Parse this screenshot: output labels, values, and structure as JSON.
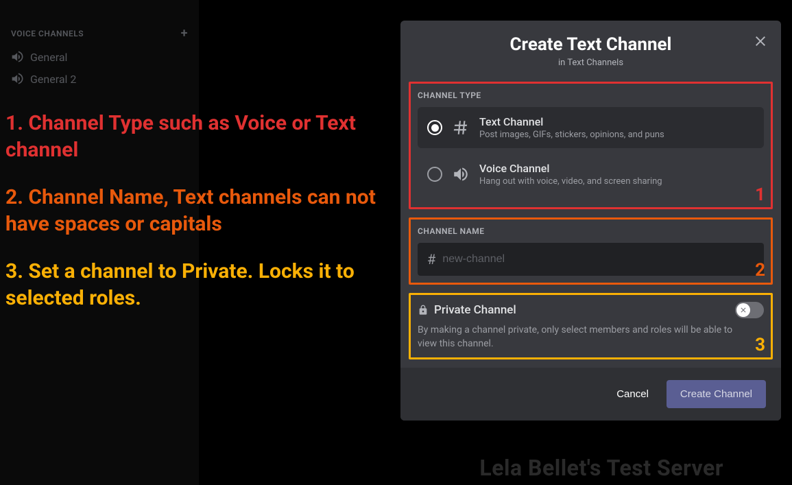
{
  "sidebar": {
    "section_label": "VOICE CHANNELS",
    "channels": [
      {
        "name": "General"
      },
      {
        "name": "General 2"
      }
    ]
  },
  "annotations": {
    "one": "1. Channel Type such as Voice or Text channel",
    "two": "2. Channel Name, Text channels can not have spaces or capitals",
    "three": "3. Set a channel to Private. Locks it to selected roles."
  },
  "modal": {
    "title": "Create Text Channel",
    "subtitle": "in Text Channels",
    "channel_type_label": "CHANNEL TYPE",
    "text_option": {
      "title": "Text Channel",
      "desc": "Post images, GIFs, stickers, opinions, and puns"
    },
    "voice_option": {
      "title": "Voice Channel",
      "desc": "Hang out with voice, video, and screen sharing"
    },
    "channel_name_label": "CHANNEL NAME",
    "channel_name_placeholder": "new-channel",
    "channel_name_value": "",
    "private": {
      "title": "Private Channel",
      "desc": "By making a channel private, only select members and roles will be able to view this channel."
    },
    "cancel_label": "Cancel",
    "create_label": "Create Channel",
    "numbers": {
      "one": "1",
      "two": "2",
      "three": "3"
    }
  },
  "watermark": "Lela Bellet's Test Server"
}
